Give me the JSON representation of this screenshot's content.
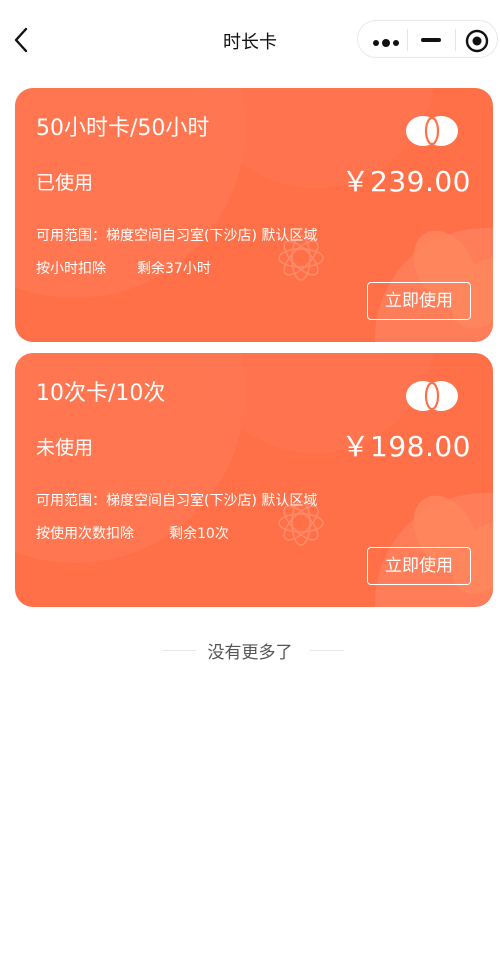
{
  "nav": {
    "title": "时长卡",
    "icons": [
      "back-icon",
      "more-icon",
      "minimize-icon",
      "target-icon"
    ]
  },
  "cards": [
    {
      "name": "50小时卡/50小时",
      "status": "已使用",
      "price": "￥239.00",
      "scope": "可用范围：梯度空间自习室(下沙店) 默认区域",
      "deduct": "按小时扣除",
      "remain": "剩余37小时",
      "button": "立即使用"
    },
    {
      "name": "10次卡/10次",
      "status": "未使用",
      "price": "￥198.00",
      "scope": "可用范围：梯度空间自习室(下沙店) 默认区域",
      "deduct": "按使用次数扣除",
      "remain": "剩余10次",
      "button": "立即使用"
    }
  ],
  "footer": {
    "text": "没有更多了"
  },
  "colors": {
    "card": "#ff7049",
    "card_pattern": "#ff8a66",
    "text_on_card": "#ffffff"
  }
}
